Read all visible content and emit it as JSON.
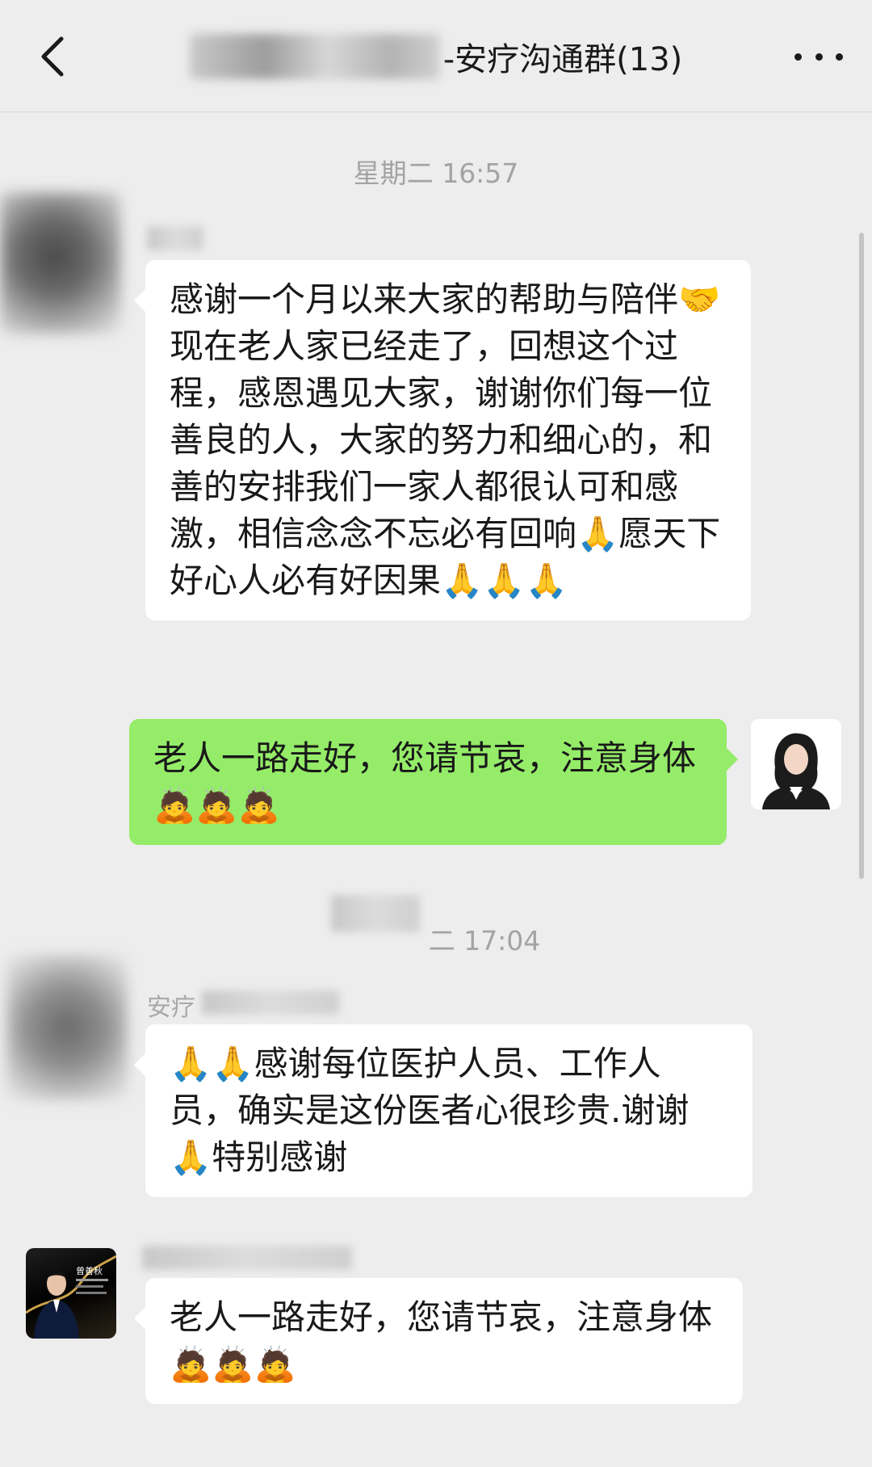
{
  "header": {
    "back_icon": "chevron-left-icon",
    "title": "-安疗沟通群(13)",
    "more_icon": "more-dots-icon"
  },
  "timestamps": {
    "first": "星期二 16:57",
    "second": "二 17:04"
  },
  "messages": [
    {
      "side": "left",
      "text": "感谢一个月以来大家的帮助与陪伴🤝现在老人家已经走了，回想这个过程，感恩遇见大家，谢谢你们每一位善良的人，大家的努力和细心的，和善的安排我们一家人都很认可和感激，相信念念不忘必有回响🙏愿天下好心人必有好因果🙏🙏🙏"
    },
    {
      "side": "right",
      "text": "老人一路走好，您请节哀，注意身体🙇🙇🙇"
    },
    {
      "side": "left",
      "sender": "安疗",
      "text": "🙏🙏感谢每位医护人员、工作人员，确实是这份医者心很珍贵.谢谢🙏特别感谢"
    },
    {
      "side": "left",
      "avatar_text": "曾善秋",
      "text": "老人一路走好，您请节哀，注意身体🙇🙇🙇"
    }
  ],
  "colors": {
    "background": "#ededed",
    "bubble_in": "#ffffff",
    "bubble_out": "#95ec69",
    "timestamp": "#a3a3a3"
  }
}
